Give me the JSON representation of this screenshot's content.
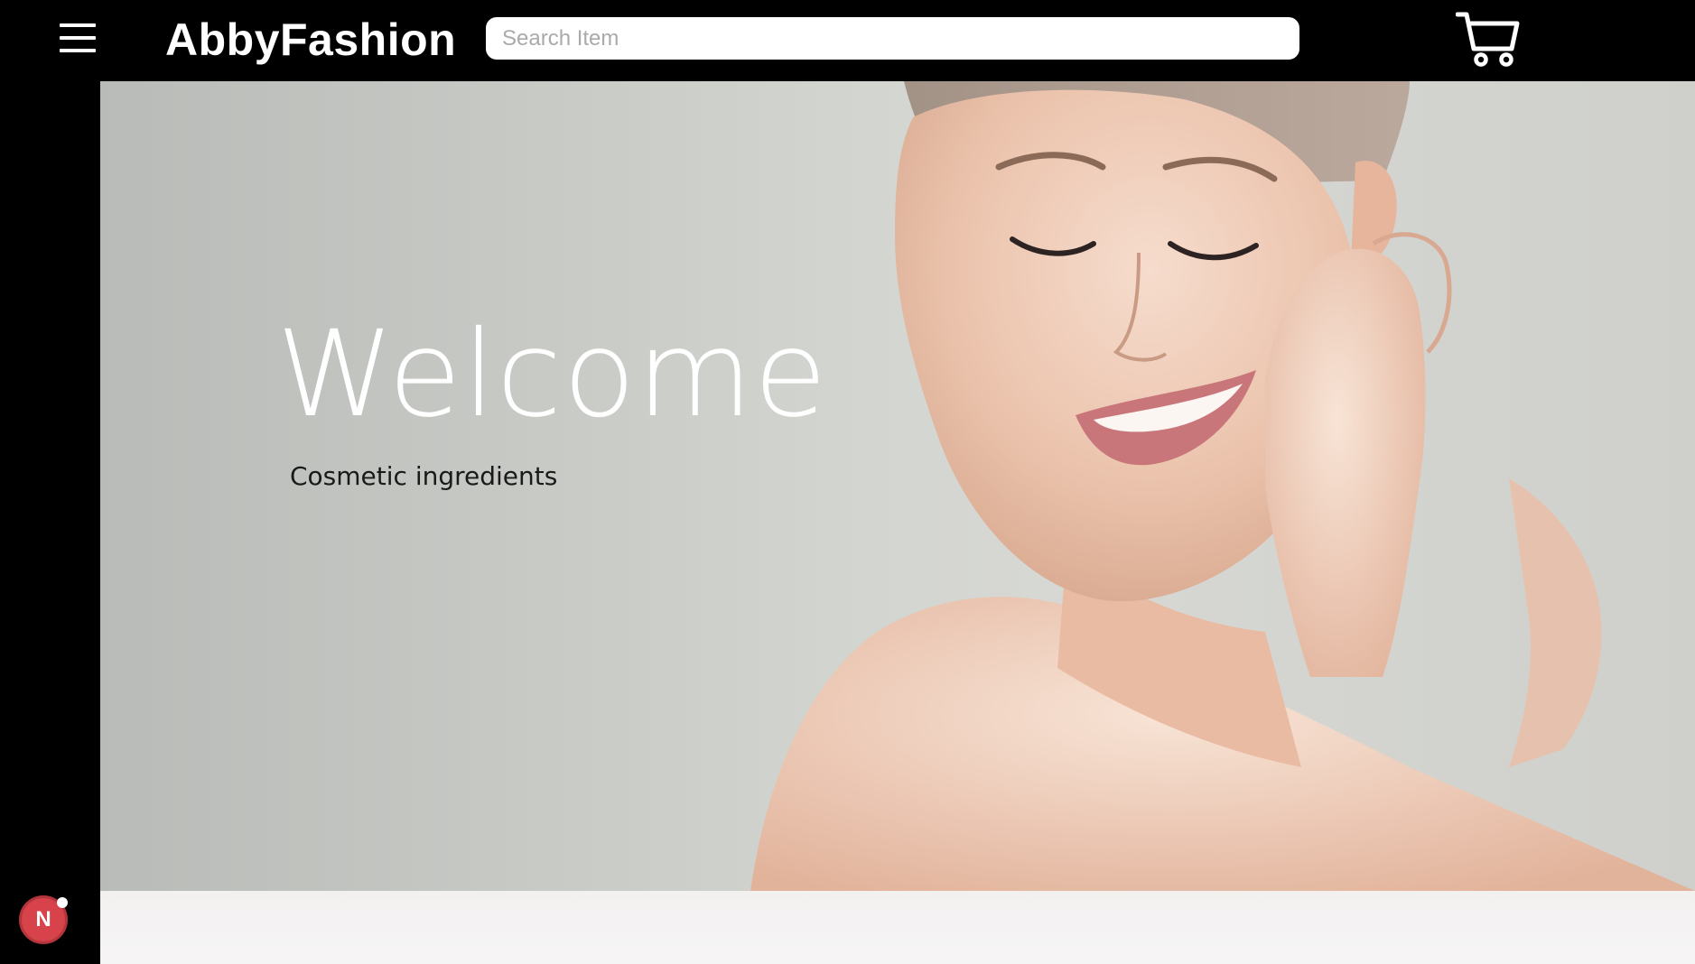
{
  "header": {
    "brand": "AbbyFashion",
    "search_placeholder": "Search Item"
  },
  "hero": {
    "title": "Welcome",
    "subtitle": "Cosmetic ingredients"
  },
  "badge": {
    "letter": "N"
  },
  "icons": {
    "menu": "hamburger-menu-icon",
    "cart": "shopping-cart-icon"
  },
  "colors": {
    "topbar": "#000000",
    "badge": "#d8434b"
  }
}
